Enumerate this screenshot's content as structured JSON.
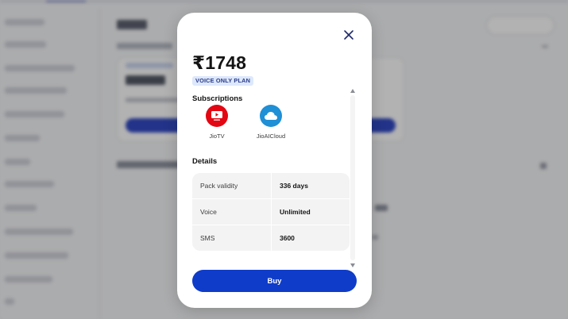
{
  "modal": {
    "price": "₹1748",
    "plan_tag": "VOICE ONLY PLAN",
    "subscriptions_title": "Subscriptions",
    "subscriptions": [
      {
        "label": "JioTV",
        "icon": "jiotv-icon",
        "color": "#e30613"
      },
      {
        "label": "JioAICloud",
        "icon": "jioaicloud-icon",
        "color": "#1f8fd6"
      }
    ],
    "details_title": "Details",
    "details": [
      {
        "key": "Pack validity",
        "value": "336 days"
      },
      {
        "key": "Voice",
        "value": "Unlimited"
      },
      {
        "key": "SMS",
        "value": "3600"
      }
    ],
    "buy_label": "Buy"
  },
  "colors": {
    "accent": "#0f3cc9",
    "tag_bg": "#dde8fb",
    "tag_text": "#2a3a8a"
  }
}
